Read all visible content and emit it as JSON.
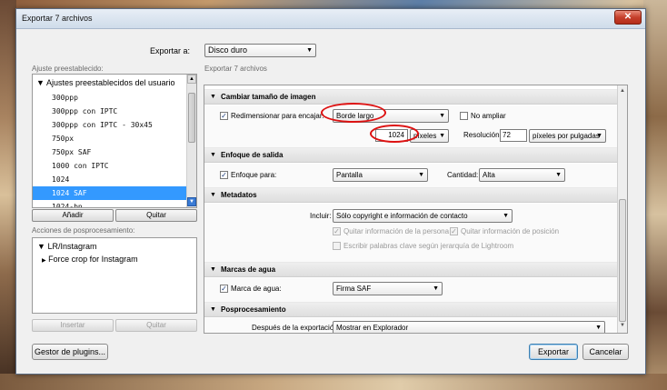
{
  "window": {
    "title": "Exportar 7 archivos",
    "close_glyph": "✕"
  },
  "export_to": {
    "label": "Exportar a:",
    "value": "Disco duro"
  },
  "presets": {
    "label": "Ajuste preestablecido:",
    "group": "Ajustes preestablecidos del usuario",
    "items": [
      "300ppp",
      "300ppp con IPTC",
      "300ppp con IPTC - 30x45",
      "750px",
      "750px SAF",
      "1000 con IPTC",
      "1024",
      "1024 SAF",
      "1024-bn"
    ],
    "selected_index": 7,
    "add_label": "Añadir",
    "remove_label": "Quitar"
  },
  "postprocess_actions": {
    "label": "Acciones de posprocesamiento:",
    "group": "LR/Instagram",
    "items": [
      "Force crop for Instagram"
    ],
    "insert_label": "Insertar",
    "remove_label": "Quitar"
  },
  "right_header": "Exportar 7 archivos",
  "resize": {
    "title": "Cambiar tamaño de imagen",
    "resize_label": "Redimensionar para encajar:",
    "resize_checked": true,
    "fit_value": "Borde largo",
    "no_enlarge_label": "No ampliar",
    "size_value": "1024",
    "unit_value": "píxeles",
    "resolution_label": "Resolución:",
    "resolution_value": "72",
    "resolution_unit": "píxeles por pulgadas"
  },
  "sharpen": {
    "title": "Enfoque de salida",
    "sharpen_label": "Enfoque para:",
    "sharpen_checked": true,
    "sharpen_value": "Pantalla",
    "amount_label": "Cantidad:",
    "amount_value": "Alta"
  },
  "metadata": {
    "title": "Metadatos",
    "include_label": "Incluir:",
    "include_value": "Sólo copyright e información de contacto",
    "remove_person_label": "Quitar información de la persona",
    "remove_location_label": "Quitar información de posición",
    "hierarchy_label": "Escribir palabras clave según jerarquía de Lightroom"
  },
  "watermark": {
    "title": "Marcas de agua",
    "watermark_label": "Marca de agua:",
    "watermark_checked": true,
    "watermark_value": "Firma SAF"
  },
  "postprocess": {
    "title": "Posprocesamiento",
    "after_label": "Después de la exportación:",
    "after_value": "Mostrar en Explorador"
  },
  "footer": {
    "plugin_manager_label": "Gestor de plugins...",
    "export_label": "Exportar",
    "cancel_label": "Cancelar"
  },
  "colors": {
    "selection": "#3399ff",
    "highlight_ellipse": "#dd1111"
  }
}
